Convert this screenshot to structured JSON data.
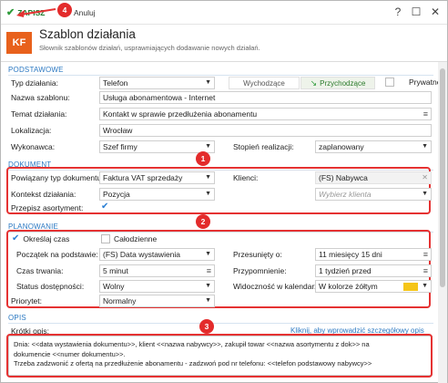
{
  "toolbar": {
    "save_label": "ZAPISZ",
    "cancel_label": "Anuluj"
  },
  "window": {
    "help": "?",
    "maximize": "☐",
    "close": "✕"
  },
  "header": {
    "logo_text": "KF",
    "title": "Szablon działania",
    "subtitle": "Słownik szablonów działań, usprawniających dodawanie nowych działań."
  },
  "sections": {
    "basic": "PODSTAWOWE",
    "document": "DOKUMENT",
    "planning": "PLANOWANIE",
    "description": "OPIS"
  },
  "basic": {
    "type_label": "Typ działania:",
    "type_value": "Telefon",
    "outgoing": "Wychodzące",
    "incoming": "Przychodzące",
    "private": "Prywatne",
    "name_label": "Nazwa szablonu:",
    "name_value": "Usługa abonamentowa - Internet",
    "subject_label": "Temat działania:",
    "subject_value": "Kontakt w sprawie przedłużenia abonamentu",
    "location_label": "Lokalizacja:",
    "location_value": "Wrocław",
    "executor_label": "Wykonawca:",
    "executor_value": "Szef firmy",
    "stage_label": "Stopień realizacji:",
    "stage_value": "zaplanowany"
  },
  "document": {
    "doc_type_label": "Powiązany typ dokumentu:",
    "doc_type_value": "Faktura VAT sprzedaży",
    "clients_label": "Klienci:",
    "clients_value": "(FS) Nabywca",
    "context_label": "Kontekst działania:",
    "context_value": "Pozycja",
    "client_placeholder": "Wybierz klienta",
    "assortment_label": "Przepisz asortyment:"
  },
  "planning": {
    "specify_time": "Określaj czas",
    "all_day": "Całodzienne",
    "start_label": "Początek na podstawie:",
    "start_value": "(FS) Data wystawienia",
    "shift_label": "Przesunięty o:",
    "shift_value": "11 miesięcy 15 dni",
    "duration_label": "Czas trwania:",
    "duration_value": "5 minut",
    "reminder_label": "Przypomnienie:",
    "reminder_value": "1 tydzień przed",
    "availability_label": "Status dostępności:",
    "availability_value": "Wolny",
    "visibility_label": "Widoczność w kalendarzu:",
    "visibility_value": "W kolorze żółtym",
    "priority_label": "Priorytet:",
    "priority_value": "Normalny"
  },
  "description": {
    "short_label": "Krótki opis:",
    "link_text": "Kliknij, aby wprowadzić szczegółowy opis",
    "line1": "Dnia: <<data wystawienia dokumentu>>, klient <<nazwa nabywcy>>, zakupił towar <<nazwa asortymentu z dok>> na",
    "line2": "dokumencie <<numer dokumentu>>.",
    "line3": "Trzeba zadzwonić z ofertą na przedłużenie abonamentu  - zadzwoń pod nr telefonu: <<telefon podstawowy nabywcy>>"
  },
  "badges": [
    "1",
    "2",
    "3",
    "4"
  ],
  "colors": {
    "accent": "#2b78c2",
    "logo": "#e8611c",
    "highlight": "#e53232",
    "calendar_color": "#f5c518"
  }
}
